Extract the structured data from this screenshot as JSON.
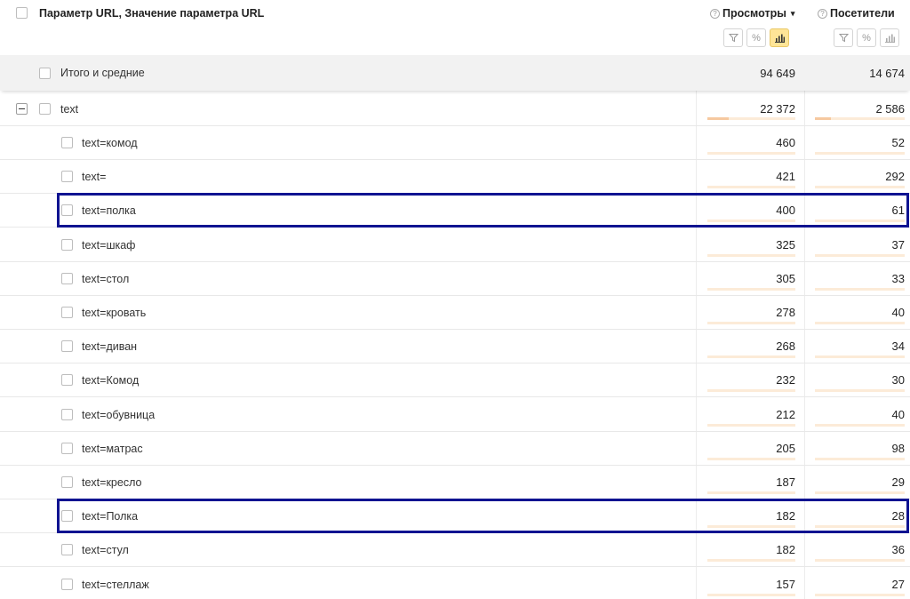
{
  "header": {
    "dimension_title": "Параметр URL, Значение параметра URL",
    "metrics": [
      {
        "label": "Просмотры",
        "sort_indicator": "▾",
        "sorted": true
      },
      {
        "label": "Посетители",
        "sorted": false
      }
    ],
    "tool_icons": [
      "filter-icon",
      "percent-icon",
      "chart-bars-icon"
    ],
    "help_glyph": "?",
    "percent_glyph": "%"
  },
  "totals": {
    "label": "Итого и средние",
    "views": "94 649",
    "visitors": "14 674"
  },
  "group": {
    "label": "text",
    "views": "22 372",
    "visitors": "2 586",
    "views_share": 0.24,
    "visitors_share": 0.18
  },
  "rows": [
    {
      "label": "text=комод",
      "views": "460",
      "visitors": "52"
    },
    {
      "label": "text=",
      "views": "421",
      "visitors": "292"
    },
    {
      "label": "text=полка",
      "views": "400",
      "visitors": "61",
      "highlighted": true
    },
    {
      "label": "text=шкаф",
      "views": "325",
      "visitors": "37"
    },
    {
      "label": "text=стол",
      "views": "305",
      "visitors": "33"
    },
    {
      "label": "text=кровать",
      "views": "278",
      "visitors": "40"
    },
    {
      "label": "text=диван",
      "views": "268",
      "visitors": "34"
    },
    {
      "label": "text=Комод",
      "views": "232",
      "visitors": "30"
    },
    {
      "label": "text=обувница",
      "views": "212",
      "visitors": "40"
    },
    {
      "label": "text=матрас",
      "views": "205",
      "visitors": "98"
    },
    {
      "label": "text=кресло",
      "views": "187",
      "visitors": "29"
    },
    {
      "label": "text=Полка",
      "views": "182",
      "visitors": "28",
      "highlighted": true
    },
    {
      "label": "text=стул",
      "views": "182",
      "visitors": "36"
    },
    {
      "label": "text=стеллаж",
      "views": "157",
      "visitors": "27"
    }
  ],
  "colors": {
    "active_tool": "#ffe597",
    "bar_fill": "#f6c9a0",
    "bar_track": "#fcebd8",
    "highlight_border": "#0f1391",
    "totals_bg": "#f2f2f2"
  }
}
